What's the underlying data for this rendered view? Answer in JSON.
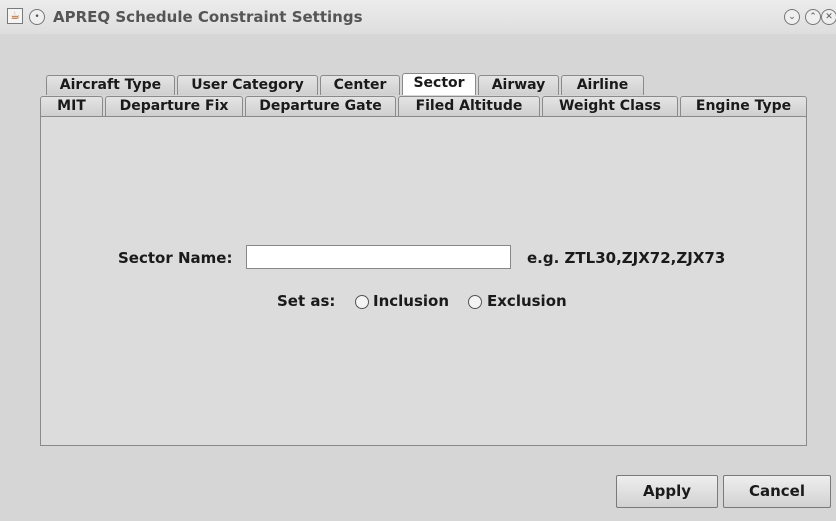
{
  "window": {
    "title": "APREQ Schedule Constraint Settings",
    "icons": [
      "java-app-icon",
      "menu-circle-icon",
      "minimize-icon",
      "maximize-icon",
      "close-icon"
    ]
  },
  "tabs": {
    "row_back": [
      {
        "label": "Aircraft Type"
      },
      {
        "label": "User Category"
      },
      {
        "label": "Center"
      },
      {
        "label": "Sector",
        "selected": true
      },
      {
        "label": "Airway"
      },
      {
        "label": "Airline"
      }
    ],
    "row_front": [
      {
        "label": "MIT"
      },
      {
        "label": "Departure Fix"
      },
      {
        "label": "Departure Gate"
      },
      {
        "label": "Filed Altitude"
      },
      {
        "label": "Weight Class"
      },
      {
        "label": "Engine Type"
      }
    ]
  },
  "form": {
    "sector_name_label": "Sector Name:",
    "sector_name_value": "",
    "example_text": "e.g. ZTL30,ZJX72,ZJX73",
    "set_as_label": "Set as:",
    "inclusion_label": "Inclusion",
    "exclusion_label": "Exclusion",
    "inclusion_selected": false,
    "exclusion_selected": false
  },
  "buttons": {
    "apply_label": "Apply",
    "cancel_label": "Cancel"
  }
}
